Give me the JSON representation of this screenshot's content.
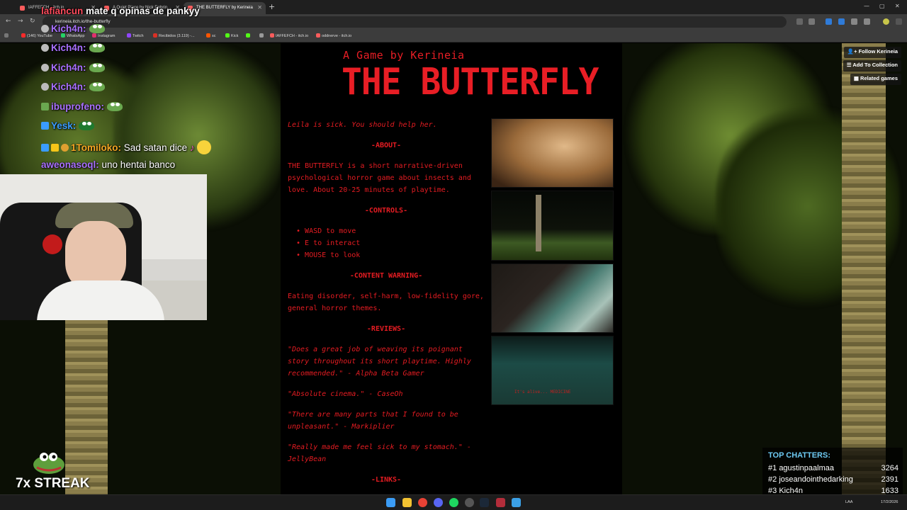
{
  "browser": {
    "tabs": [
      {
        "title": "IAFFEFCH - itch.io",
        "active": false
      },
      {
        "title": "A Quiet Place by Nick Dobrin...",
        "active": false
      },
      {
        "title": "THE BUTTERFLY by Kerineia",
        "active": true
      }
    ],
    "url": "kerineia.itch.io/the-butterfly",
    "bookmarks": [
      "(146) YouTube",
      "WhatsApp",
      "Instagram",
      "Twitch",
      "Recibidos (3.119) -...",
      "sc",
      "Kick",
      "",
      "",
      "IAFFEFCH - itch.io",
      "oddnerve - itch.io"
    ]
  },
  "page": {
    "kicker": "A Game by Kerineia",
    "title": "THE BUTTERFLY",
    "tagline": "Leila is sick. You should help her.",
    "about_header": "-ABOUT-",
    "about_text": "THE BUTTERFLY is a short narrative-driven psychological horror game about insects and love. About 20-25 minutes of playtime.",
    "controls_header": "-CONTROLS-",
    "controls": [
      "WASD to move",
      "E to interact",
      "MOUSE to look"
    ],
    "warning_header": "-CONTENT WARNING-",
    "warning_text": "Eating disorder, self-harm, low-fidelity gore, general horror themes.",
    "reviews_header": "-REVIEWS-",
    "reviews": [
      "\"Does a great job of weaving its poignant story throughout its short playtime. Highly recommended.\" - Alpha Beta Gamer",
      "\"Absolute cinema.\" - CaseOh",
      "\"There are many parts that I found to be unpleasant.\" - Markiplier",
      "\"Really made me feel sick to my stomach.\" - JellyBean"
    ],
    "links_header": "-LINKS-",
    "buttons": {
      "follow": "Follow Kerineia",
      "collection": "Add To Collection",
      "related": "Related games"
    },
    "screenshot_caption": "It's alive... MEDICINE"
  },
  "overlay": {
    "top_message": {
      "user": "lafiancun",
      "text": "mate q opinas de pankyy"
    },
    "chat": [
      {
        "user": "Kich4n:",
        "color": "#a970ff",
        "text": ""
      },
      {
        "user": "Kich4n:",
        "color": "#a970ff",
        "text": ""
      },
      {
        "user": "Kich4n:",
        "color": "#a970ff",
        "text": ""
      },
      {
        "user": "Kich4n:",
        "color": "#a970ff",
        "text": ""
      },
      {
        "user": "ibuprofeno:",
        "color": "#a970ff",
        "text": ""
      },
      {
        "user": "Yesk:",
        "color": "#3a9cff",
        "text": ""
      },
      {
        "user": "1Tomiloko:",
        "color": "#f5a623",
        "text": "Sad satan dice"
      },
      {
        "user": "aweonasoql:",
        "color": "#a970ff",
        "text": "uno hentai banco"
      }
    ],
    "streak": "7x STREAK",
    "top_chatters": {
      "title": "TOP CHATTERS:",
      "rows": [
        {
          "rank": "#1",
          "name": "agustinpaalmaa",
          "count": "3264"
        },
        {
          "rank": "#2",
          "name": "joseandointhedarking",
          "count": "2391"
        },
        {
          "rank": "#3",
          "name": "Kich4n",
          "count": "1633"
        }
      ]
    }
  },
  "taskbar": {
    "lang": "LAA",
    "date": "17/2/2026"
  }
}
